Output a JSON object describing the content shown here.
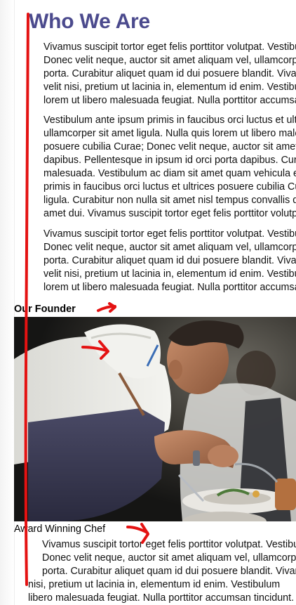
{
  "heading": "Who We Are",
  "paragraphs": [
    {
      "lines": [
        "Vivamus suscipit tortor eget felis porttitor volutpat. Vestibulum",
        "Donec velit neque, auctor sit amet aliquam vel, ullamcorper",
        "porta. Curabitur aliquet quam id dui posuere blandit. Vivamus",
        "velit nisi, pretium ut lacinia in, elementum id enim. Vestibulum",
        "lorem ut libero malesuada feugiat. Nulla porttitor accumsan"
      ]
    },
    {
      "lines": [
        "Vestibulum ante ipsum primis in faucibus orci luctus et ultrices",
        "ullamcorper sit amet ligula. Nulla quis lorem ut libero malesuada",
        "posuere cubilia Curae; Donec velit neque, auctor sit amet aliquam",
        "dapibus. Pellentesque in ipsum id orci porta dapibus. Curabitur",
        "malesuada. Vestibulum ac diam sit amet quam vehicula elementum",
        "primis in faucibus orci luctus et ultrices posuere cubilia Curae",
        "ligula. Curabitur non nulla sit amet nisl tempus convallis quis",
        "amet dui. Vivamus suscipit tortor eget felis porttitor volutpat."
      ]
    },
    {
      "lines": [
        "Vivamus suscipit tortor eget felis porttitor volutpat. Vestibulum",
        "Donec velit neque, auctor sit amet aliquam vel, ullamcorper",
        "porta. Curabitur aliquet quam id dui posuere blandit. Vivamus",
        "velit nisi, pretium ut lacinia in, elementum id enim. Vestibulum",
        "lorem ut libero malesuada feugiat. Nulla porttitor accumsan"
      ]
    }
  ],
  "founder": {
    "label": "Our Founder",
    "caption": "Award Winning Chef"
  },
  "bottom_paragraph": {
    "lines": [
      "Vivamus suscipit tortor eget felis porttitor volutpat. Vestibulum",
      "Donec velit neque, auctor sit amet aliquam vel, ullamcorper",
      "porta. Curabitur aliquet quam id dui posuere blandit. Vivamus",
      "nisi, pretium ut lacinia in, elementum id enim. Vestibulum",
      "libero malesuada feugiat. Nulla porttitor accumsan tincidunt."
    ]
  },
  "colors": {
    "heading": "#4b4a8d",
    "annotation": "#e41212"
  }
}
